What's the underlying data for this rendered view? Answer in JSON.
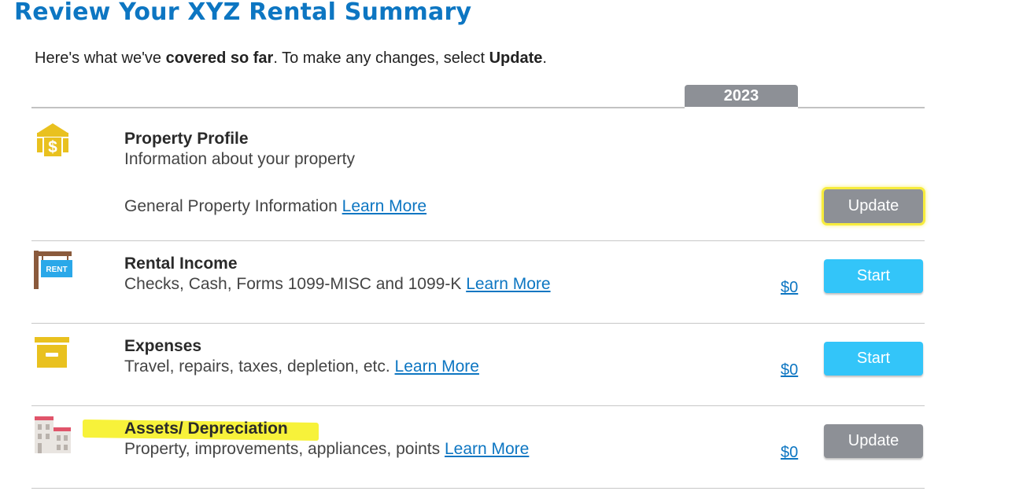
{
  "header": {
    "title": "Review Your XYZ Rental Summary",
    "intro_a": "Here's what we've ",
    "intro_b": "covered so far",
    "intro_c": ". To make any changes, select ",
    "intro_d": "Update",
    "intro_e": "."
  },
  "table": {
    "year": "2023"
  },
  "rows": [
    {
      "title": "Property Profile",
      "description": "Information about your property",
      "sub_text": "General Property Information ",
      "link": "Learn More",
      "button": "Update"
    },
    {
      "title": "Rental Income",
      "description": "Checks, Cash, Forms 1099-MISC and 1099-K ",
      "link": "Learn More",
      "amount": "$0",
      "button": "Start",
      "icon_text": "RENT"
    },
    {
      "title": "Expenses",
      "description": "Travel, repairs, taxes, depletion, etc. ",
      "link": "Learn More",
      "amount": "$0",
      "button": "Start"
    },
    {
      "title": "Assets/ Depreciation",
      "description": "Property, improvements, appliances, points ",
      "link": "Learn More",
      "amount": "$0",
      "button": "Update"
    }
  ],
  "colors": {
    "accent": "#0d76c2",
    "start_button": "#33c5f9",
    "update_button": "#8d9096",
    "highlight": "#f7f23a"
  },
  "icons": [
    "property-dollar-icon",
    "rent-sign-icon",
    "expenses-box-icon",
    "buildings-icon"
  ]
}
